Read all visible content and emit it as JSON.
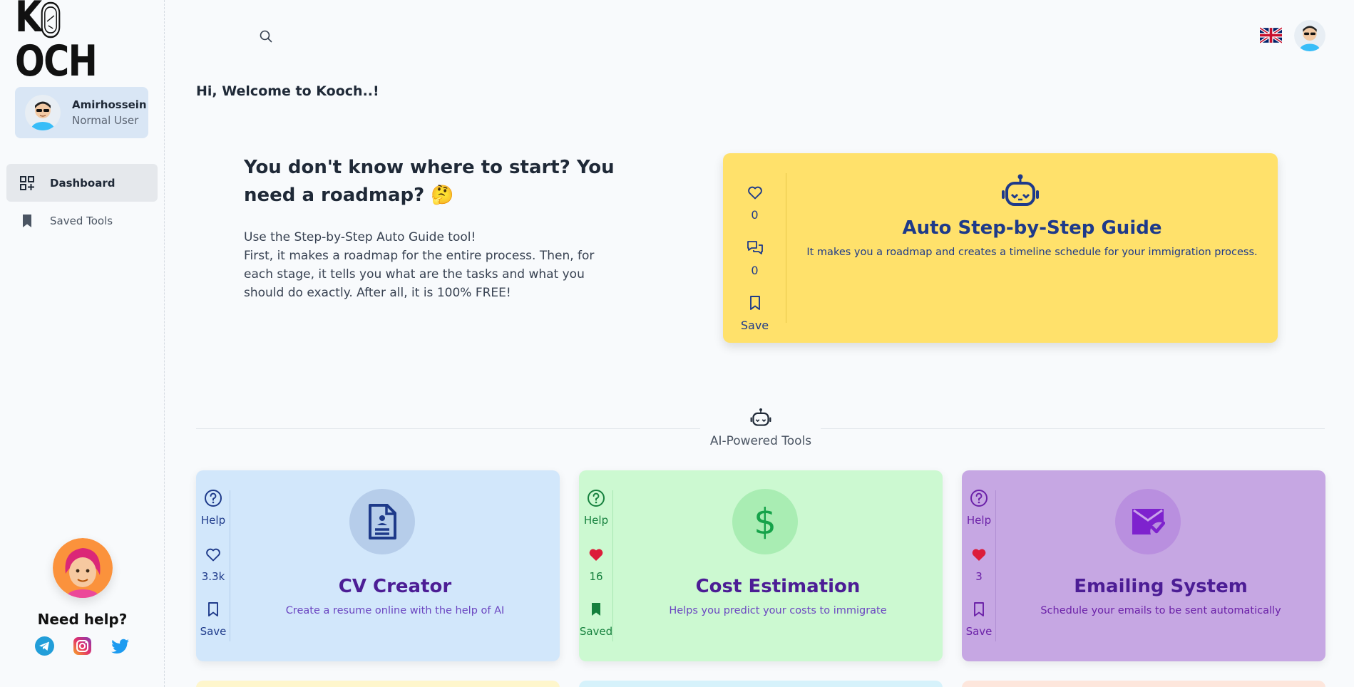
{
  "brand": {
    "logo_k": "K",
    "logo_och": "OCH"
  },
  "user": {
    "name": "Amirhossein",
    "role": "Normal User"
  },
  "nav": [
    {
      "label": "Dashboard",
      "icon": "dashboard-grid-icon",
      "active": true
    },
    {
      "label": "Saved Tools",
      "icon": "bookmark-icon",
      "active": false
    }
  ],
  "help": {
    "title": "Need help?",
    "socials": [
      "telegram-icon",
      "instagram-icon",
      "twitter-icon"
    ]
  },
  "welcome": "Hi, Welcome to Kooch..!",
  "hero": {
    "title": "You don't know where to start? You need a roadmap? 🤔",
    "line1": "Use the Step-by-Step Auto Guide tool!",
    "line2": "First, it makes a roadmap for the entire process. Then, for each stage, it tells you what are the tasks and what you should do exactly. After all, it is 100% FREE!"
  },
  "guide": {
    "title": "Auto Step-by-Step Guide",
    "desc": "It makes you a roadmap and creates a timeline schedule for your immigration process.",
    "likes": "0",
    "comments": "0",
    "save_label": "Save",
    "color": "#ffe16b",
    "accent": "#1e3a8a"
  },
  "section": {
    "title": "AI-Powered Tools"
  },
  "tools": [
    {
      "title": "CV Creator",
      "desc": "Create a resume online with the help of AI",
      "help_label": "Help",
      "likes": "3.3k",
      "liked": false,
      "save_label": "Save",
      "saved": false,
      "bg": "#d2e7fb",
      "accent": "#1e3a8a",
      "title_color": "#4c1d95"
    },
    {
      "title": "Cost Estimation",
      "desc": "Helps you predict your costs to immigrate",
      "help_label": "Help",
      "likes": "16",
      "liked": true,
      "save_label": "Saved",
      "saved": true,
      "bg": "#ccf9d1",
      "accent": "#15803d",
      "title_color": "#4c1d95"
    },
    {
      "title": "Emailing System",
      "desc": "Schedule your emails to be sent automatically",
      "help_label": "Help",
      "likes": "3",
      "liked": true,
      "save_label": "Save",
      "saved": false,
      "bg": "#c6a7e3",
      "accent": "#6b21a8",
      "title_color": "#4c1d95"
    }
  ]
}
